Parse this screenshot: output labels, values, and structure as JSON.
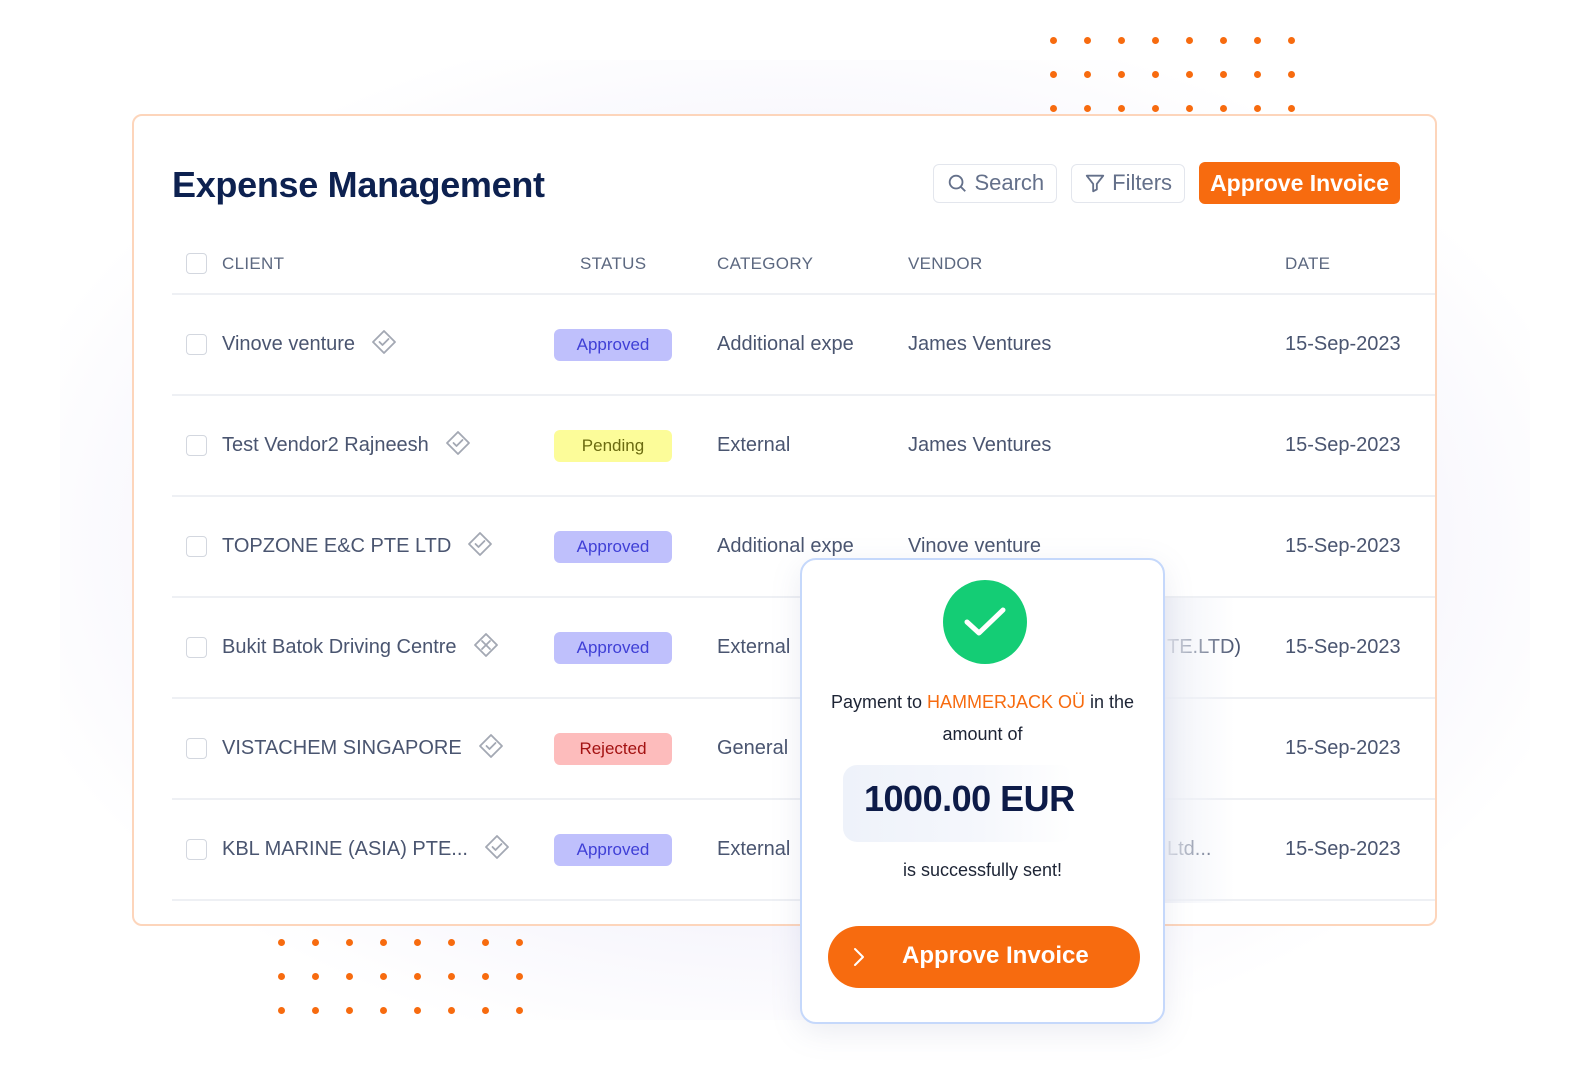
{
  "app": {
    "title": "Expense Management",
    "toolbar": {
      "search_label": "Search",
      "filters_label": "Filters",
      "approve_label": "Approve Invoice"
    }
  },
  "colors": {
    "accent": "#f76b0f",
    "title": "#0d2150",
    "success": "#14cd75",
    "approved_bg": "#bfc0fc",
    "approved_text": "#3f3fd6",
    "pending_bg": "#fcfc99",
    "pending_text": "#6b6b10",
    "rejected_bg": "#fdbcbc",
    "rejected_text": "#a31212"
  },
  "table": {
    "columns": [
      "CLIENT",
      "STATUS",
      "CATEGORY",
      "VENDOR",
      "DATE"
    ],
    "rows": [
      {
        "client": "Vinove venture",
        "verify_icon": "verified-check-icon",
        "status": "Approved",
        "status_type": "approved",
        "category": "Additional expe",
        "vendor": "James Ventures",
        "date": "15-Sep-2023"
      },
      {
        "client": "Test Vendor2 Rajneesh",
        "verify_icon": "verified-check-icon",
        "status": "Pending",
        "status_type": "pending",
        "category": "External",
        "vendor": "James Ventures",
        "date": "15-Sep-2023"
      },
      {
        "client": "TOPZONE E&C PTE LTD",
        "verify_icon": "verified-check-icon",
        "status": "Approved",
        "status_type": "approved",
        "category": "Additional expe",
        "vendor": "Vinove venture",
        "date": "15-Sep-2023"
      },
      {
        "client": "Bukit Batok Driving Centre",
        "verify_icon": "unverified-x-icon",
        "status": "Approved",
        "status_type": "approved",
        "category": "External",
        "vendor": "TE.LTD)",
        "date": "15-Sep-2023"
      },
      {
        "client": "VISTACHEM SINGAPORE",
        "verify_icon": "verified-check-icon",
        "status": "Rejected",
        "status_type": "rejected",
        "category": "General",
        "vendor": "",
        "date": "15-Sep-2023"
      },
      {
        "client": "KBL MARINE (ASIA) PTE...",
        "verify_icon": "verified-check-icon",
        "status": "Approved",
        "status_type": "approved",
        "category": "External",
        "vendor": "Ltd...",
        "date": "15-Sep-2023"
      }
    ]
  },
  "popup": {
    "icon": "success-check-icon",
    "message_prefix": "Payment to ",
    "payee": "HAMMERJACK OÜ",
    "message_suffix": " in the amount of",
    "amount": "1000.00 EUR",
    "sent_text": "is successfully sent!",
    "button_label": "Approve Invoice"
  }
}
